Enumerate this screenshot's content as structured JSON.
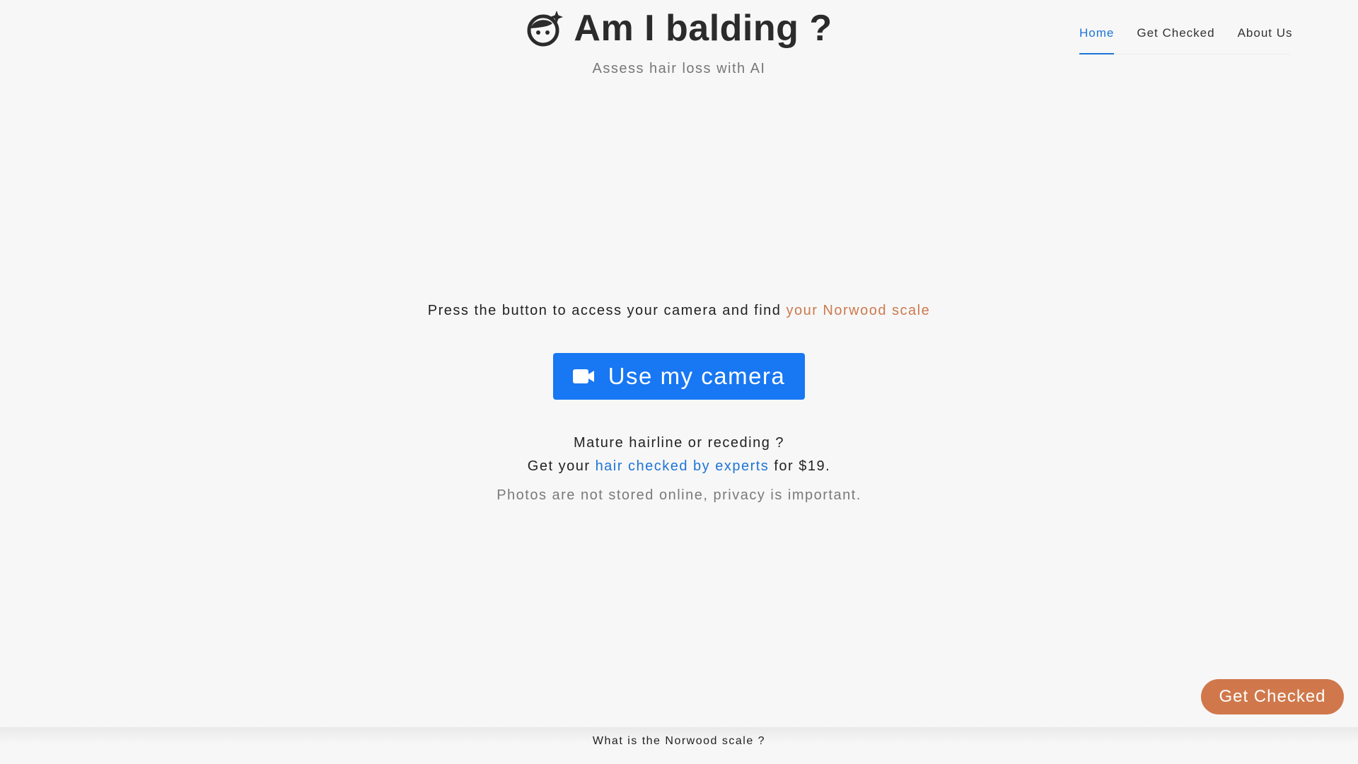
{
  "header": {
    "title": "Am I balding ?",
    "subtitle": "Assess hair loss with AI",
    "logo_icon": "bald-face-sparkle-icon"
  },
  "nav": {
    "items": [
      {
        "label": "Home",
        "active": true
      },
      {
        "label": "Get Checked",
        "active": false
      },
      {
        "label": "About Us",
        "active": false
      }
    ]
  },
  "main": {
    "intro_text": "Press the button to access your camera and find ",
    "intro_link": "your Norwood scale",
    "camera_button": {
      "label": "Use my camera",
      "icon": "video-camera-icon"
    },
    "mature_text": "Mature hairline or receding ?",
    "get_prefix": "Get your ",
    "get_link": "hair checked by experts",
    "get_suffix": " for $19.",
    "privacy_text": "Photos are not stored online, privacy is important."
  },
  "float_button": {
    "label": "Get Checked"
  },
  "footer": {
    "link": "What is the Norwood scale ?"
  },
  "colors": {
    "primary_blue": "#1877f2",
    "link_blue": "#1d74d6",
    "accent_orange": "#d0784c",
    "background": "#f7f7f7"
  }
}
